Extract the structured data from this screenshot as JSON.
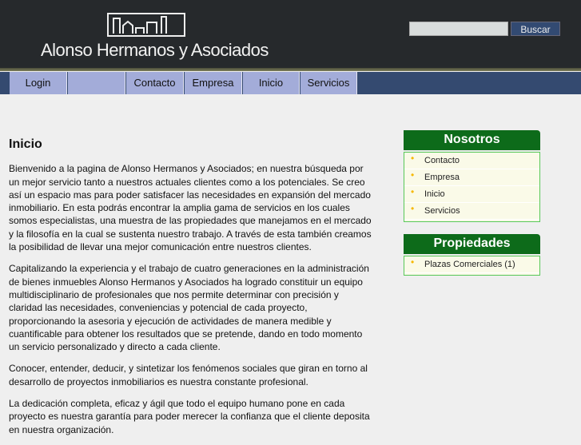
{
  "header": {
    "title": "Alonso Hermanos y Asociados",
    "search_placeholder": "",
    "search_button": "Buscar"
  },
  "nav": [
    "Login",
    "",
    "Contacto",
    "Empresa",
    "Inicio",
    "Servicios"
  ],
  "main": {
    "heading": "Inicio",
    "paragraphs": [
      "Bienvenido a la pagina de Alonso Hermanos y Asociados; en nuestra búsqueda por un mejor servicio tanto a nuestros actuales clientes como a los potenciales. Se creo así un espacio mas para poder satisfacer las necesidades en expansión del mercado inmobiliario. En esta podrás encontrar la amplia gama de servicios en los cuales somos especialistas, una muestra de las propiedades que manejamos en el mercado y la filosofía en la cual se sustenta nuestro trabajo. A través de esta también creamos la posibilidad de llevar una mejor comunicación entre nuestros clientes.",
      "Capitalizando la experiencia y el trabajo de cuatro generaciones en la administración de bienes inmuebles Alonso Hermanos y Asociados ha logrado constituir un equipo multidisciplinario de profesionales que nos permite determinar con precisión y claridad las necesidades, conveniencias y potencial de cada proyecto, proporcionando la asesoria y ejecución de actividades de manera medible y cuantificable para obtener los resultados que se pretende, dando en todo momento un servicio personalizado y directo a cada cliente.",
      "Conocer, entender, deducir, y sintetizar los fenómenos sociales que giran en torno al desarrollo de proyectos inmobiliarios es nuestra constante profesional.",
      "La dedicación completa, eficaz y ágil que todo el equipo humano pone en cada proyecto es nuestra garantía para poder merecer la confianza que el cliente deposita en nuestra organización."
    ]
  },
  "sidebar": {
    "nosotros": {
      "title": "Nosotros",
      "items": [
        "Contacto",
        "Empresa",
        "Inicio",
        "Servicios"
      ]
    },
    "propiedades": {
      "title": "Propiedades",
      "items": [
        "Plazas Comerciales (1)"
      ]
    }
  },
  "colors": {
    "nav_tab": "#a3acd9",
    "nav_bar": "#344a70",
    "box_header": "#0d6b1a"
  }
}
